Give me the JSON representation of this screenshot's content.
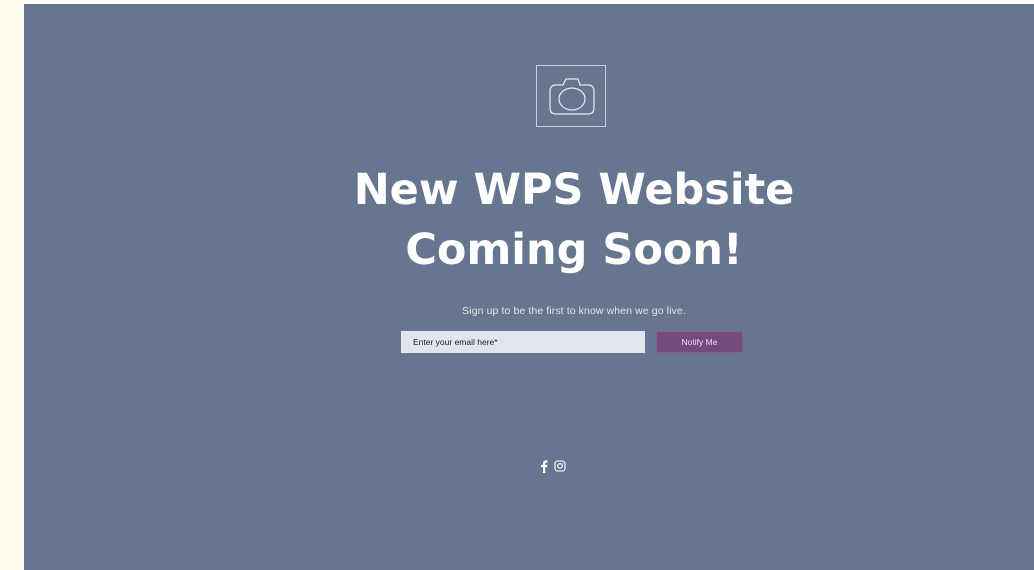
{
  "hero": {
    "logo_icon": "camera-outline-icon",
    "headline_line1": "New WPS Website",
    "headline_line2": "Coming Soon!",
    "subtitle": "Sign up to be the first to know when we go live."
  },
  "signup": {
    "email_placeholder": "Enter your email here*",
    "email_value": "",
    "button_label": "Notify Me"
  },
  "social": {
    "links": [
      {
        "icon": "facebook-icon"
      },
      {
        "icon": "instagram-icon"
      }
    ]
  },
  "colors": {
    "page_background": "#67768f",
    "outer_background": "#fffdf0",
    "input_background": "#e3e5ee",
    "button_background": "#734b7e",
    "headline_text": "#ffffff"
  }
}
